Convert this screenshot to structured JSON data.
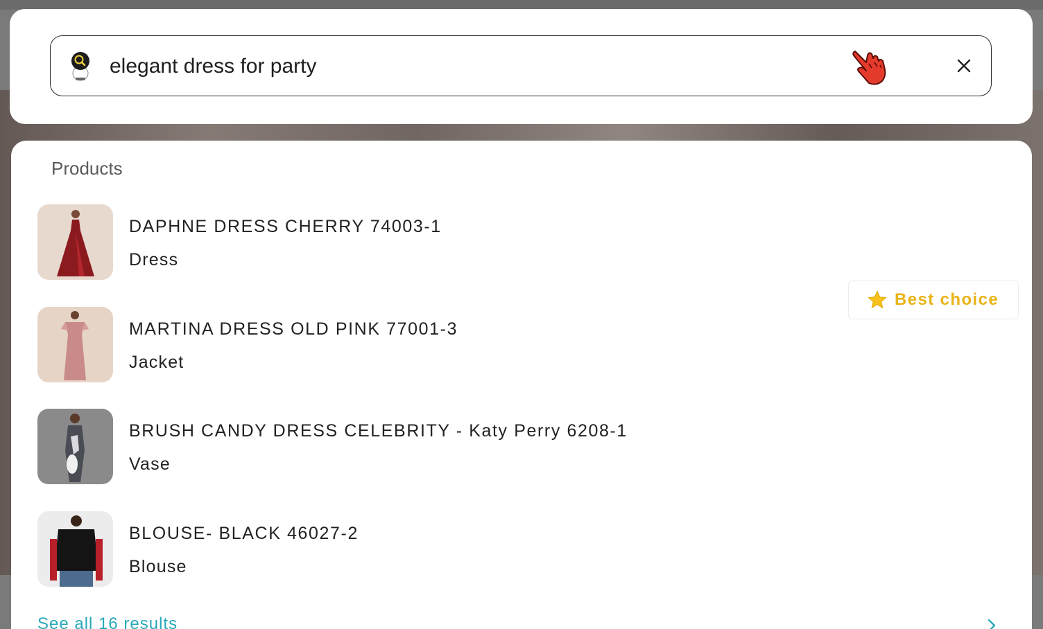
{
  "search": {
    "query": "elegant dress for party",
    "placeholder": ""
  },
  "results": {
    "section_title": "Products",
    "products": [
      {
        "name": "DAPHNE DRESS CHERRY 74003-1",
        "type": "Dress",
        "thumb_color": "#8b1a1f"
      },
      {
        "name": "MARTINA DRESS OLD PINK 77001-3",
        "type": "Jacket",
        "thumb_color": "#c98a8a"
      },
      {
        "name": "BRUSH CANDY DRESS CELEBRITY - Katy Perry 6208-1",
        "type": "Vase",
        "thumb_color": "#4a4c55"
      },
      {
        "name": "BLOUSE- BLACK 46027-2",
        "type": "Blouse",
        "thumb_color": "#141414"
      }
    ],
    "badge": {
      "label": "Best choice",
      "icon": "star-icon"
    },
    "see_all": "See all 16 results"
  },
  "colors": {
    "accent": "#27a9b8",
    "badge": "#e8b417",
    "hand": "#e53b2c"
  }
}
